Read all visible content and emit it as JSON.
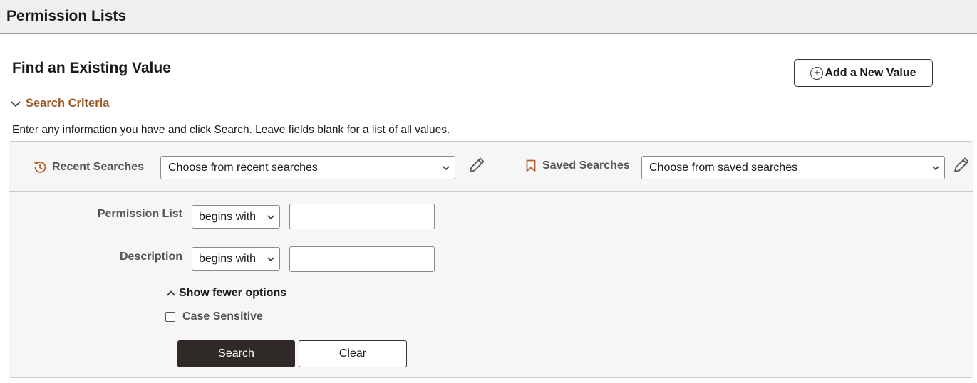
{
  "header": {
    "title": "Permission Lists"
  },
  "main": {
    "title": "Find an Existing Value",
    "add_button_label": "Add a New Value",
    "criteria_toggle_label": "Search Criteria",
    "instructions": "Enter any information you have and click Search. Leave fields blank for a list of all values."
  },
  "recent": {
    "label": "Recent Searches",
    "selected": "Choose from recent searches"
  },
  "saved": {
    "label": "Saved Searches",
    "selected": "Choose from saved searches"
  },
  "fields": [
    {
      "label": "Permission List",
      "operator": "begins with",
      "value": ""
    },
    {
      "label": "Description",
      "operator": "begins with",
      "value": ""
    }
  ],
  "options": {
    "fewer_label": "Show fewer options",
    "case_sensitive_label": "Case Sensitive",
    "case_sensitive_checked": false
  },
  "actions": {
    "search_label": "Search",
    "clear_label": "Clear"
  },
  "colors": {
    "accent_brown": "#9c5a2b",
    "primary_button": "#2f2a28",
    "header_bg": "#f0efee",
    "panel_bg": "#f6f6f6"
  },
  "icons": {
    "history": "history-icon",
    "bookmark": "bookmark-icon",
    "pencil": "pencil-icon",
    "add": "add-circle-icon",
    "chevron_down": "chevron-down-icon",
    "chevron_up": "chevron-up-icon"
  }
}
